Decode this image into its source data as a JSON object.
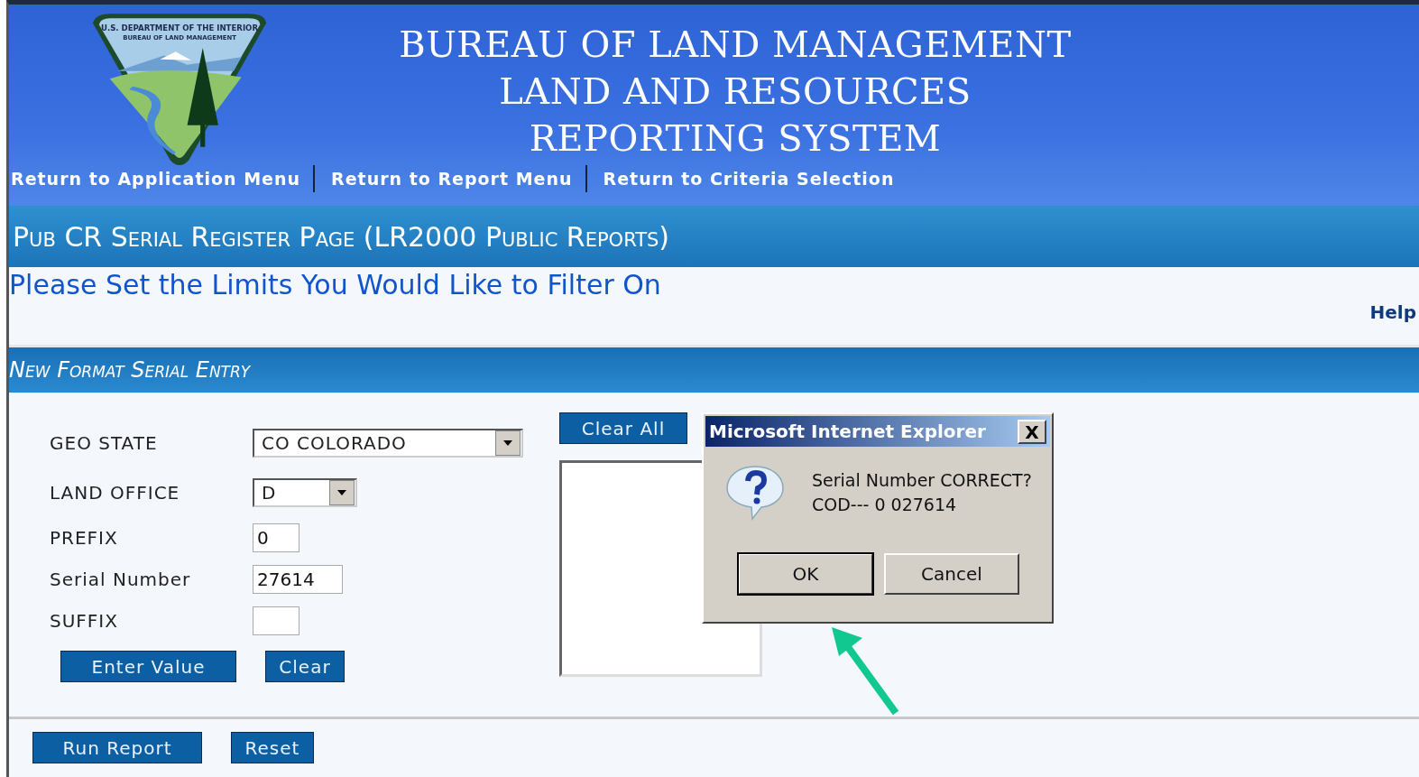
{
  "header": {
    "logo_text": [
      "U.S. DEPARTMENT OF THE INTERIOR",
      "BUREAU OF LAND MANAGEMENT"
    ],
    "title_lines": [
      "BUREAU OF LAND MANAGEMENT",
      "LAND AND RESOURCES",
      "REPORTING SYSTEM"
    ],
    "nav": [
      "Return to Application Menu",
      "Return to Report Menu",
      "Return to Criteria Selection"
    ]
  },
  "page_title": "Pub CR Serial Register Page (LR2000 Public Reports)",
  "instruction": "Please Set the Limits You Would Like to Filter On",
  "help_link": "Help",
  "section_title": "New Format Serial Entry",
  "fields": [
    {
      "label": "GEO STATE",
      "kind": "select",
      "value": "CO COLORADO"
    },
    {
      "label": "LAND OFFICE",
      "kind": "select",
      "value": "D"
    },
    {
      "label": "PREFIX",
      "kind": "text",
      "value": "0"
    },
    {
      "label": "Serial Number",
      "kind": "text",
      "value": "27614"
    },
    {
      "label": "SUFFIX",
      "kind": "text"
    }
  ],
  "form_buttons": [
    "Enter Value",
    "Clear"
  ],
  "clear_all_button": "Clear All",
  "footer_buttons": [
    "Run Report",
    "Reset"
  ],
  "dialog": {
    "title": "Microsoft Internet Explorer",
    "close": "X",
    "message_lines": [
      "Serial Number CORRECT?",
      "COD--- 0 027614"
    ],
    "buttons": [
      {
        "label": "OK",
        "selected": true
      },
      {
        "label": "Cancel",
        "selected": false
      }
    ]
  }
}
